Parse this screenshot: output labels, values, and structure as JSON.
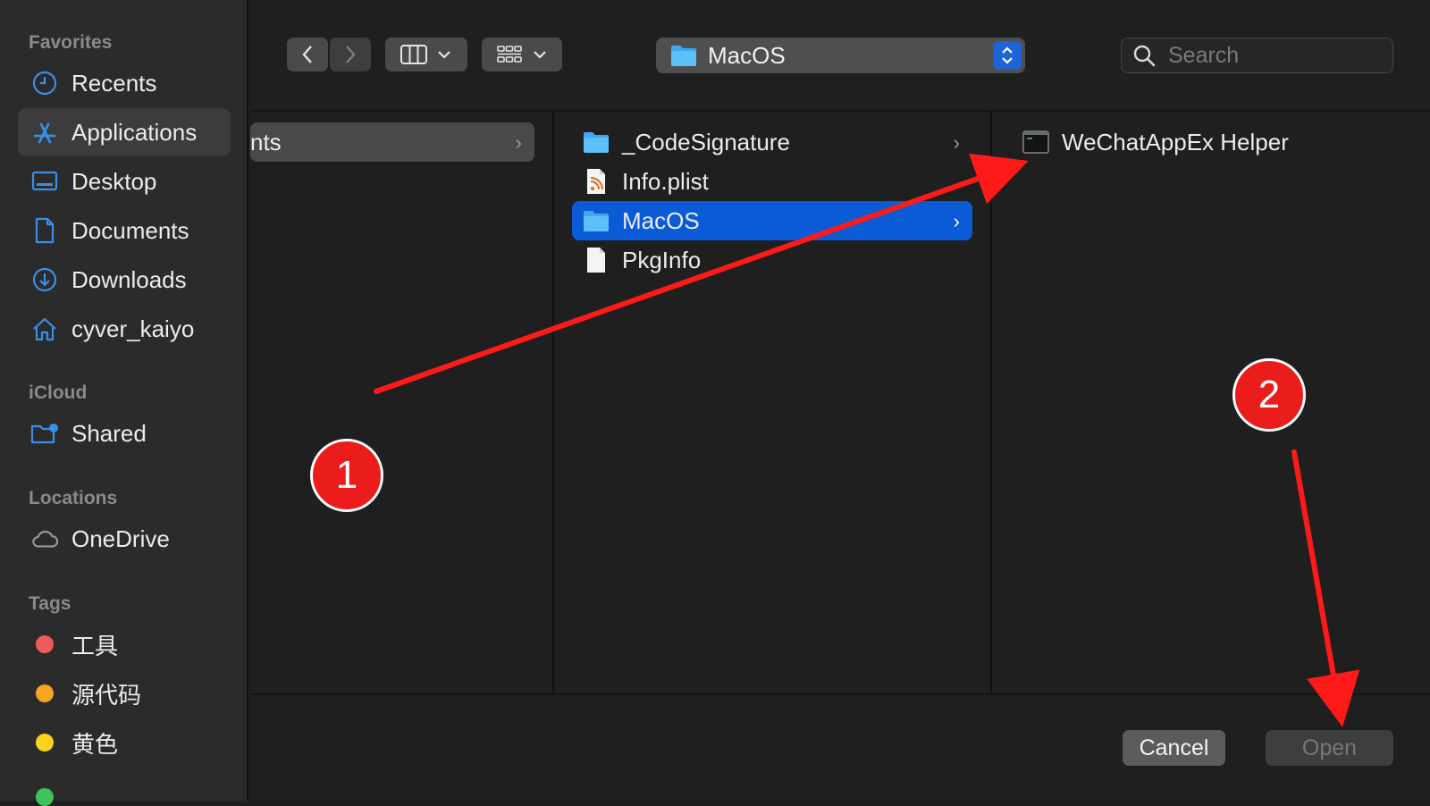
{
  "sidebar": {
    "sections": {
      "favorites": "Favorites",
      "icloud": "iCloud",
      "locations": "Locations",
      "tags": "Tags"
    },
    "favorites": [
      {
        "label": "Recents",
        "icon": "clock-icon"
      },
      {
        "label": "Applications",
        "icon": "app-store-icon",
        "active": true
      },
      {
        "label": "Desktop",
        "icon": "desktop-icon"
      },
      {
        "label": "Documents",
        "icon": "document-icon"
      },
      {
        "label": "Downloads",
        "icon": "download-icon"
      },
      {
        "label": "cyver_kaiyo",
        "icon": "home-icon"
      }
    ],
    "icloud": [
      {
        "label": "Shared",
        "icon": "shared-folder-icon"
      }
    ],
    "locations": [
      {
        "label": "OneDrive",
        "icon": "cloud-icon"
      }
    ],
    "tags": [
      {
        "label": "工具",
        "color": "#ec5b56"
      },
      {
        "label": "源代码",
        "color": "#f5a623"
      },
      {
        "label": "黄色",
        "color": "#f7d21e"
      }
    ]
  },
  "toolbar": {
    "back_icon": "chevron-left-icon",
    "forward_icon": "chevron-right-icon",
    "view_icon": "columns-icon",
    "group_icon": "grid-icon",
    "path": "MacOS",
    "search_placeholder": "Search"
  },
  "columns": {
    "col1": [
      {
        "label": "nts",
        "has_children": true,
        "highlighted": true
      }
    ],
    "col2": [
      {
        "label": "_CodeSignature",
        "icon": "folder-icon",
        "has_children": true
      },
      {
        "label": "Info.plist",
        "icon": "plist-file-icon"
      },
      {
        "label": "MacOS",
        "icon": "folder-icon",
        "has_children": true,
        "selected": true
      },
      {
        "label": "PkgInfo",
        "icon": "file-icon"
      }
    ],
    "col3": [
      {
        "label": "WeChatAppEx Helper",
        "icon": "terminal-executable-icon"
      }
    ]
  },
  "footer": {
    "cancel_label": "Cancel",
    "open_label": "Open"
  },
  "annotations": {
    "step1": "1",
    "step2": "2",
    "arrow_color": "#ff1a1a"
  }
}
